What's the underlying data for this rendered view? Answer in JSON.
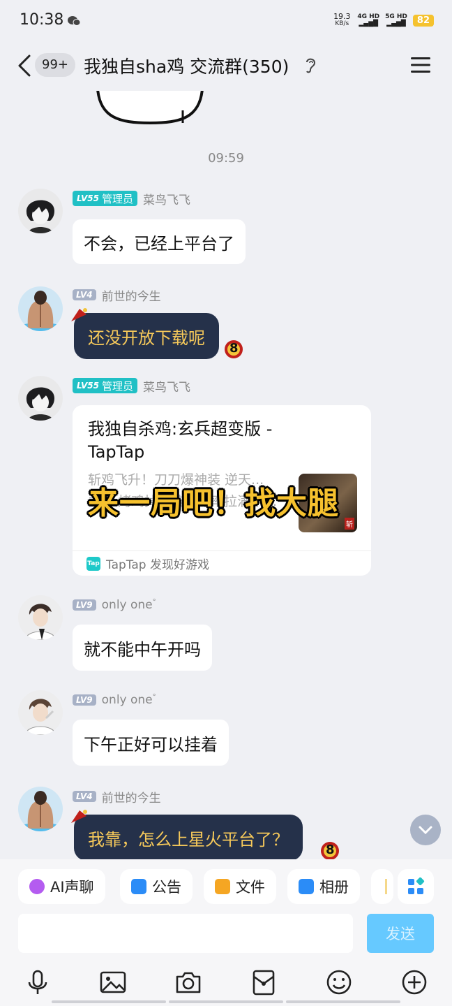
{
  "status_bar": {
    "time": "10:38",
    "net_speed_value": "19.3",
    "net_speed_unit": "KB/s",
    "signal1": "4G HD",
    "signal2": "5G HD",
    "battery": "82"
  },
  "header": {
    "unread": "99+",
    "title": "我独自sha鸡 交流群(350)"
  },
  "chat": {
    "time_separator": "09:59",
    "messages": [
      {
        "level": "LV55",
        "role": "管理员",
        "sender": "菜鸟飞飞",
        "text": "不会，已经上平台了"
      },
      {
        "level": "LV4",
        "sender": "前世的今生",
        "text": "还没开放下载呢"
      },
      {
        "level": "LV55",
        "role": "管理员",
        "sender": "菜鸟飞飞"
      },
      {
        "level": "LV9",
        "sender": "only one",
        "sender_suffix": "°",
        "text": "就不能中午开吗"
      },
      {
        "level": "LV9",
        "sender": "only one",
        "sender_suffix": "°",
        "text": "下午正好可以挂着"
      },
      {
        "level": "LV4",
        "sender": "前世的今生",
        "text": "我靠，怎么上星火平台了？"
      }
    ],
    "card": {
      "title": "我独自杀鸡:玄兵超变版 - TapTap",
      "desc": "斩鸡飞升！刀刀爆神装 逆天... 主... 烤鸡掉神装！爆率拉满不…",
      "source_badge": "Tap",
      "source": "TapTap 发现好游戏"
    },
    "overlay": "来一局吧！找大腿",
    "badge_num": "8"
  },
  "quick_actions": [
    {
      "label": "AI声聊",
      "color": "#b45cf0"
    },
    {
      "label": "公告",
      "color": "#2b8cf7"
    },
    {
      "label": "文件",
      "color": "#f5a623"
    },
    {
      "label": "相册",
      "color": "#2b8cf7"
    }
  ],
  "input": {
    "placeholder": "",
    "send_label": "发送"
  },
  "toolbar": [
    "microphone-icon",
    "image-icon",
    "camera-icon",
    "red-packet-icon",
    "emoji-icon",
    "plus-icon"
  ]
}
